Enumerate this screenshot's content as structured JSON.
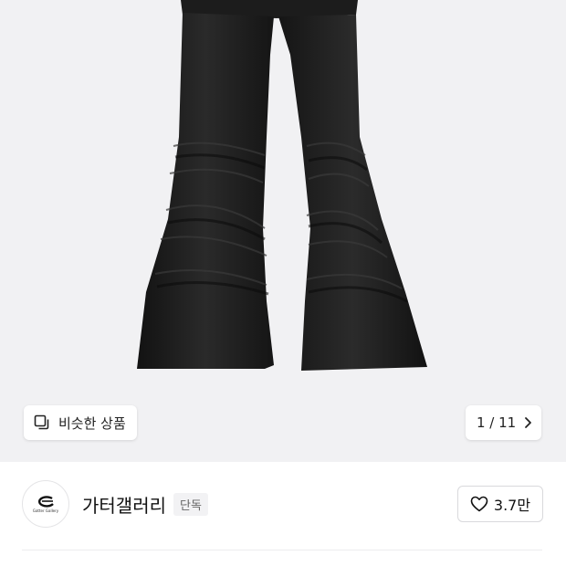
{
  "similar": {
    "label": "비슷한 상품"
  },
  "gallery": {
    "counter": "1 / 11"
  },
  "seller": {
    "name": "가터갤러리",
    "badge": "단독",
    "logo_text": "Gatter Gallery"
  },
  "likes": {
    "count": "3.7만"
  },
  "icons": {
    "similar": "similar-products-icon",
    "next": "chevron-right-icon",
    "like": "heart-outline-icon"
  },
  "colors": {
    "hero_background": "#f1f1f3",
    "product": "#1a1a1a"
  }
}
